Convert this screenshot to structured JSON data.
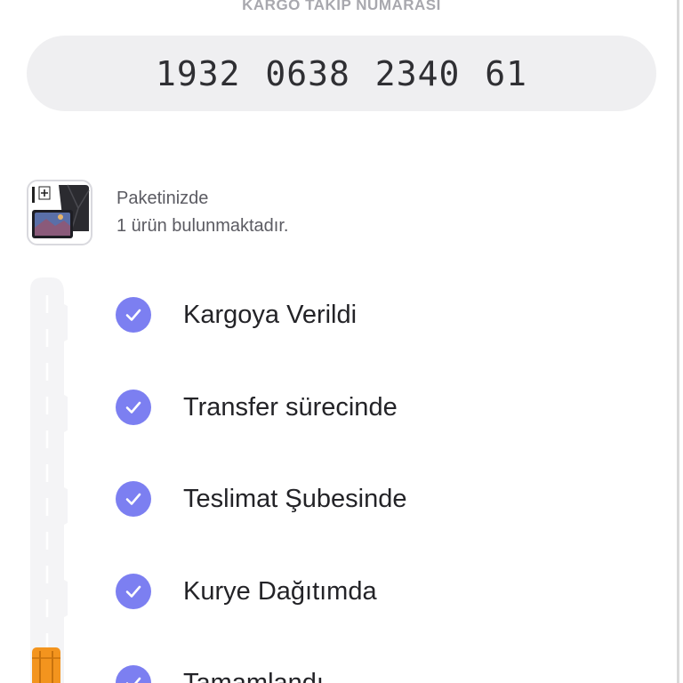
{
  "tracking": {
    "title": "KARGO TAKİP NUMARASI",
    "number": "1932 0638 2340 61"
  },
  "package": {
    "line1": "Paketinizde",
    "line2": "1 ürün bulunmaktadır.",
    "thumb_icon": "tablet-case-product-icon"
  },
  "steps": [
    {
      "label": "Kargoya Verildi",
      "status": "completed"
    },
    {
      "label": "Transfer sürecinde",
      "status": "completed"
    },
    {
      "label": "Teslimat Şubesinde",
      "status": "completed"
    },
    {
      "label": "Kurye Dağıtımda",
      "status": "completed"
    },
    {
      "label": "Tamamlandı",
      "status": "completed"
    }
  ],
  "colors": {
    "accent": "#7c7ff1",
    "tracking_box_bg": "#efeff1",
    "road": "#f4f4f6",
    "cargo_box": "#f3941e"
  }
}
